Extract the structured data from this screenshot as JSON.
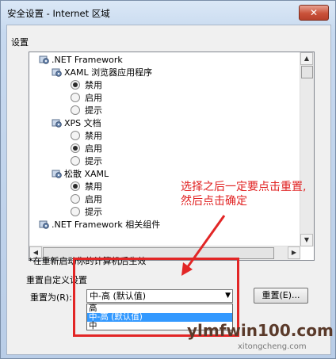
{
  "window": {
    "title": "安全设置 - Internet 区域",
    "close_symbol": "✕"
  },
  "settings": {
    "group_label": "设置",
    "tree": [
      {
        "kind": "node",
        "indent": 0,
        "icon": "settings-gear-icon",
        "label": ".NET Framework"
      },
      {
        "kind": "node",
        "indent": 1,
        "icon": "settings-gear-icon",
        "label": "XAML 浏览器应用程序"
      },
      {
        "kind": "radio",
        "indent": 2,
        "checked": true,
        "label": "禁用"
      },
      {
        "kind": "radio",
        "indent": 2,
        "checked": false,
        "label": "启用"
      },
      {
        "kind": "radio",
        "indent": 2,
        "checked": false,
        "label": "提示"
      },
      {
        "kind": "node",
        "indent": 1,
        "icon": "settings-gear-icon",
        "label": "XPS 文档"
      },
      {
        "kind": "radio",
        "indent": 2,
        "checked": false,
        "label": "禁用"
      },
      {
        "kind": "radio",
        "indent": 2,
        "checked": true,
        "label": "启用"
      },
      {
        "kind": "radio",
        "indent": 2,
        "checked": false,
        "label": "提示"
      },
      {
        "kind": "node",
        "indent": 1,
        "icon": "settings-gear-icon",
        "label": "松散 XAML"
      },
      {
        "kind": "radio",
        "indent": 2,
        "checked": true,
        "label": "禁用"
      },
      {
        "kind": "radio",
        "indent": 2,
        "checked": false,
        "label": "启用"
      },
      {
        "kind": "radio",
        "indent": 2,
        "checked": false,
        "label": "提示"
      },
      {
        "kind": "node",
        "indent": 0,
        "icon": "settings-gear-icon",
        "label": ".NET Framework 相关组件"
      }
    ],
    "restart_note": "*在重新启动你的计算机后生效"
  },
  "reset": {
    "group_label": "重置自定义设置",
    "reset_to_label": "重置为(R):",
    "selected": "中-高 (默认值)",
    "options": [
      "高",
      "中-高 (默认值)",
      "中"
    ],
    "selected_index": 1,
    "button_label": "重置(E)..."
  },
  "annotation": {
    "text_line1": "选择之后一定要点击重置,",
    "text_line2": "然后点击确定",
    "color": "#e02020"
  },
  "watermark": {
    "domain": "ylmfwin100.com",
    "sub": "xitongcheng.com"
  }
}
